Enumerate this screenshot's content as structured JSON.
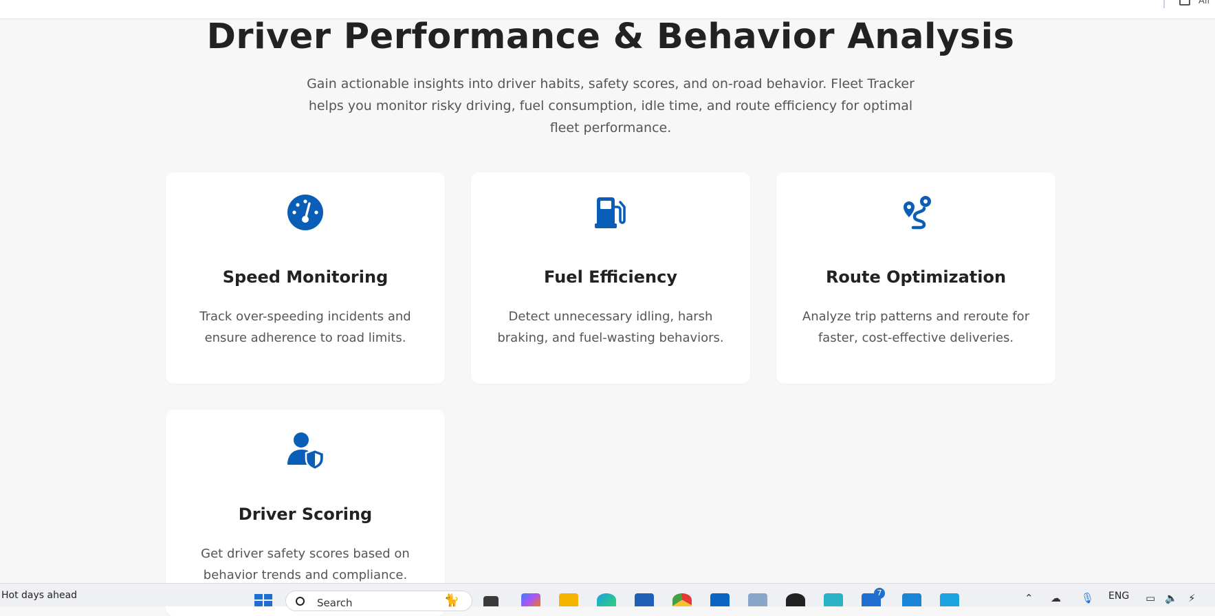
{
  "topbar": {
    "right_text": "All"
  },
  "hero": {
    "title": "Driver Performance & Behavior Analysis",
    "intro": "Gain actionable insights into driver habits, safety scores, and on-road behavior. Fleet Tracker helps you monitor risky driving, fuel consumption, idle time, and route efficiency for optimal fleet performance."
  },
  "features": [
    {
      "title": "Speed Monitoring",
      "desc": "Track over-speeding incidents and ensure adherence to road limits.",
      "icon": "speedometer-icon"
    },
    {
      "title": "Fuel Efficiency",
      "desc": "Detect unnecessary idling, harsh braking, and fuel-wasting behaviors.",
      "icon": "gas-pump-icon"
    },
    {
      "title": "Route Optimization",
      "desc": "Analyze trip patterns and reroute for faster, cost-effective deliveries.",
      "icon": "route-icon"
    },
    {
      "title": "Driver Scoring",
      "desc": "Get driver safety scores based on behavior trends and compliance.",
      "icon": "user-shield-icon"
    }
  ],
  "colors": {
    "accent": "#0a5eb8",
    "background": "#f7f7f7",
    "card": "#ffffff"
  },
  "taskbar": {
    "weather": "Hot days ahead",
    "search_placeholder": "Search",
    "notification_count": "7",
    "language": "ENG"
  }
}
